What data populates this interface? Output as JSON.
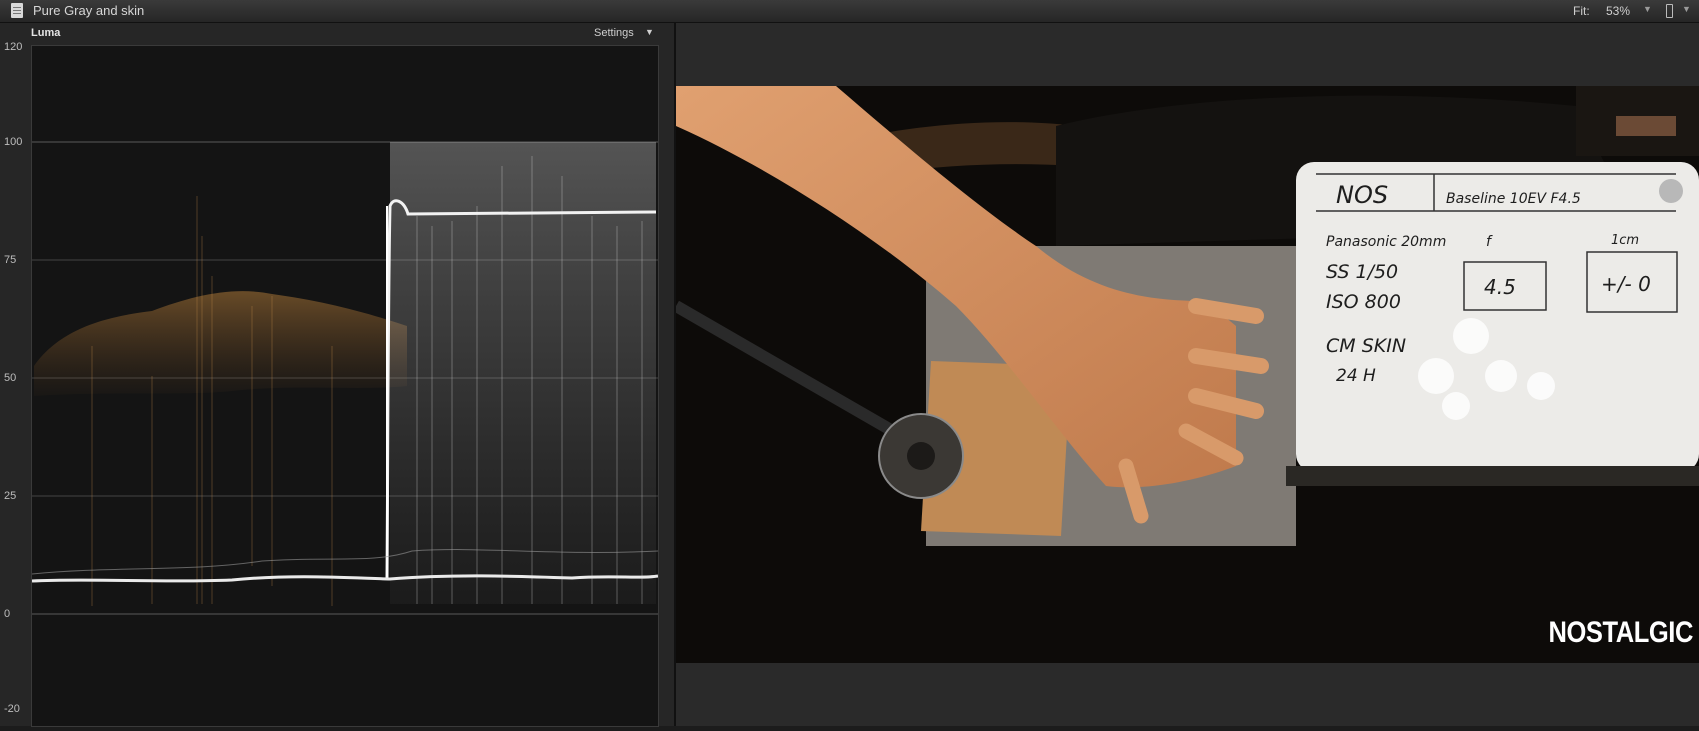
{
  "window": {
    "title": "Pure Gray and skin",
    "fit_label": "Fit:",
    "zoom": "53%"
  },
  "scope": {
    "name": "Luma",
    "settings_label": "Settings",
    "axis_ticks": [
      "120",
      "100",
      "75",
      "50",
      "25",
      "0",
      "-20"
    ]
  },
  "viewer": {
    "watermark": "NOSTALGIC",
    "slate": {
      "roll": "NOS",
      "line1": "Baseline 10EV F4.5",
      "lens": "Panasonic 20mm",
      "shutter": "SS 1/50",
      "iso": "ISO 800",
      "profile": "CM SKIN",
      "note": "24 H",
      "box1_header": "f",
      "box1_value": "4.5",
      "box2_header": "1cm",
      "box2_value": "+/- 0"
    }
  }
}
